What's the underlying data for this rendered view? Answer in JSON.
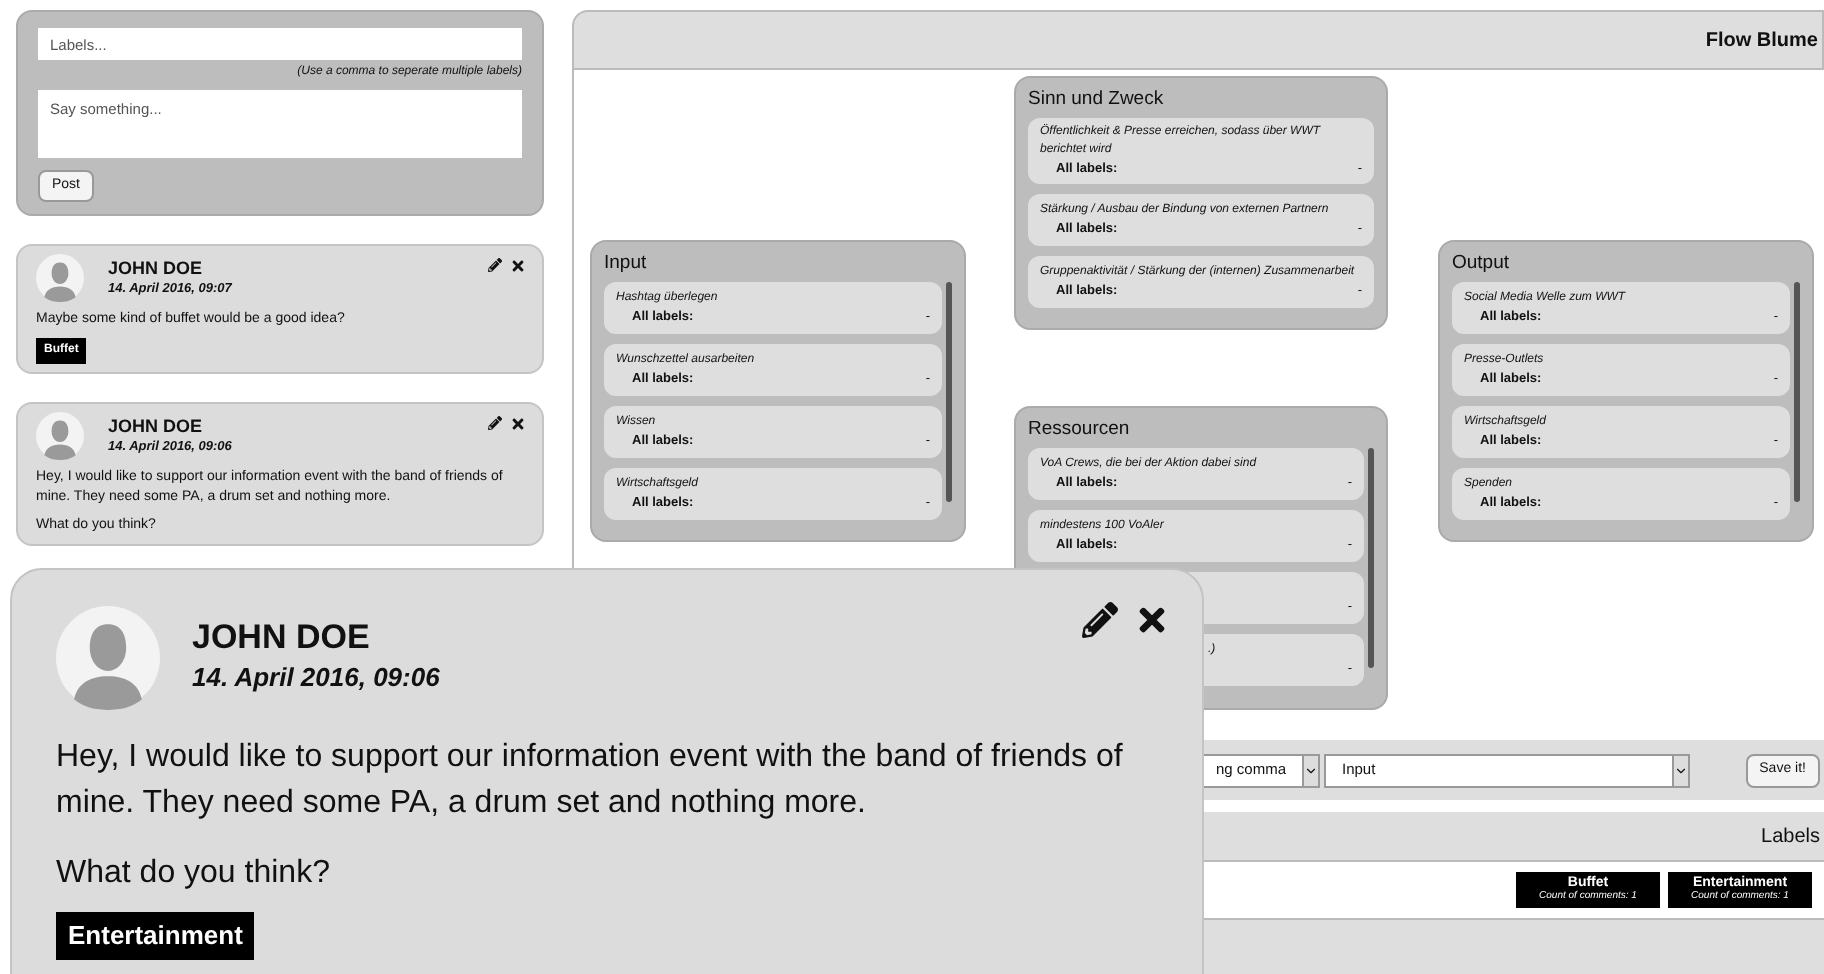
{
  "composer": {
    "labels_placeholder": "Labels...",
    "labels_hint": "(Use a comma to seperate multiple labels)",
    "message_placeholder": "Say something...",
    "post_button": "Post"
  },
  "comments": [
    {
      "author": "JOHN DOE",
      "date": "14. April 2016, 09:07",
      "paragraphs": [
        "Maybe some kind of buffet would be a good idea?"
      ],
      "labels": [
        "Buffet"
      ]
    },
    {
      "author": "JOHN DOE",
      "date": "14. April 2016, 09:06",
      "paragraphs": [
        "Hey, I would like to support our information event with the band of friends of mine. They need some PA, a drum set and nothing more.",
        "What do you think?"
      ]
    }
  ],
  "board": {
    "title": "Flow Blume",
    "groups": [
      {
        "title": "Sinn und Zweck",
        "items": [
          {
            "kind": "full",
            "title": "Öffentlichkeit & Presse erreichen, sodass über WWT berichtet wird",
            "caption": "All labels:",
            "value": "-"
          },
          {
            "kind": "full",
            "title": "Stärkung / Ausbau der Bindung von externen Partnern",
            "caption": "All labels:",
            "value": "-"
          },
          {
            "kind": "full",
            "title": "Gruppenaktivität / Stärkung der (internen) Zusammenarbeit",
            "caption": "All labels:",
            "value": "-"
          }
        ]
      },
      {
        "title": "Input",
        "items": [
          {
            "kind": "full",
            "title": "Hashtag überlegen",
            "caption": "All labels:",
            "value": "-"
          },
          {
            "kind": "full",
            "title": "Wunschzettel ausarbeiten",
            "caption": "All labels:",
            "value": "-"
          },
          {
            "kind": "full",
            "title": "Wissen",
            "caption": "All labels:",
            "value": "-"
          },
          {
            "kind": "full",
            "title": "Wirtschaftsgeld",
            "caption": "All labels:",
            "value": "-"
          }
        ]
      },
      {
        "title": "Ressourcen",
        "items": [
          {
            "kind": "full",
            "title": "VoA Crews, die bei der Aktion dabei sind",
            "caption": "All labels:",
            "value": "-"
          },
          {
            "kind": "full",
            "title": "mindestens 100 VoAler",
            "caption": "All labels:",
            "value": "-"
          },
          {
            "kind": "partial",
            "value": "-"
          },
          {
            "kind": "partial",
            "title": ".)",
            "value": "-"
          }
        ]
      },
      {
        "title": "Output",
        "items": [
          {
            "kind": "full",
            "title": "Social Media Welle zum WWT",
            "caption": "All labels:",
            "value": "-"
          },
          {
            "kind": "full",
            "title": "Presse-Outlets",
            "caption": "All labels:",
            "value": "-"
          },
          {
            "kind": "full",
            "title": "Wirtschaftsgeld",
            "caption": "All labels:",
            "value": "-"
          },
          {
            "kind": "full",
            "title": "Spenden",
            "caption": "All labels:",
            "value": "-"
          }
        ]
      }
    ]
  },
  "assign_bar": {
    "label_select": "ng comma",
    "group_select": "Input",
    "save_button": "Save it!"
  },
  "labels_panel": {
    "title": "Labels",
    "labels": [
      {
        "name": "Buffet",
        "count": "Count of comments: 1"
      },
      {
        "name": "Entertainment",
        "count": "Count of comments: 1"
      }
    ]
  },
  "popup": {
    "author": "JOHN DOE",
    "date": "14. April 2016, 09:06",
    "paragraphs": [
      "Hey, I would like to support our information event with the band of friends of mine. They need some PA, a drum set and nothing more.",
      "What do you think?"
    ],
    "labels": [
      "Entertainment"
    ]
  }
}
